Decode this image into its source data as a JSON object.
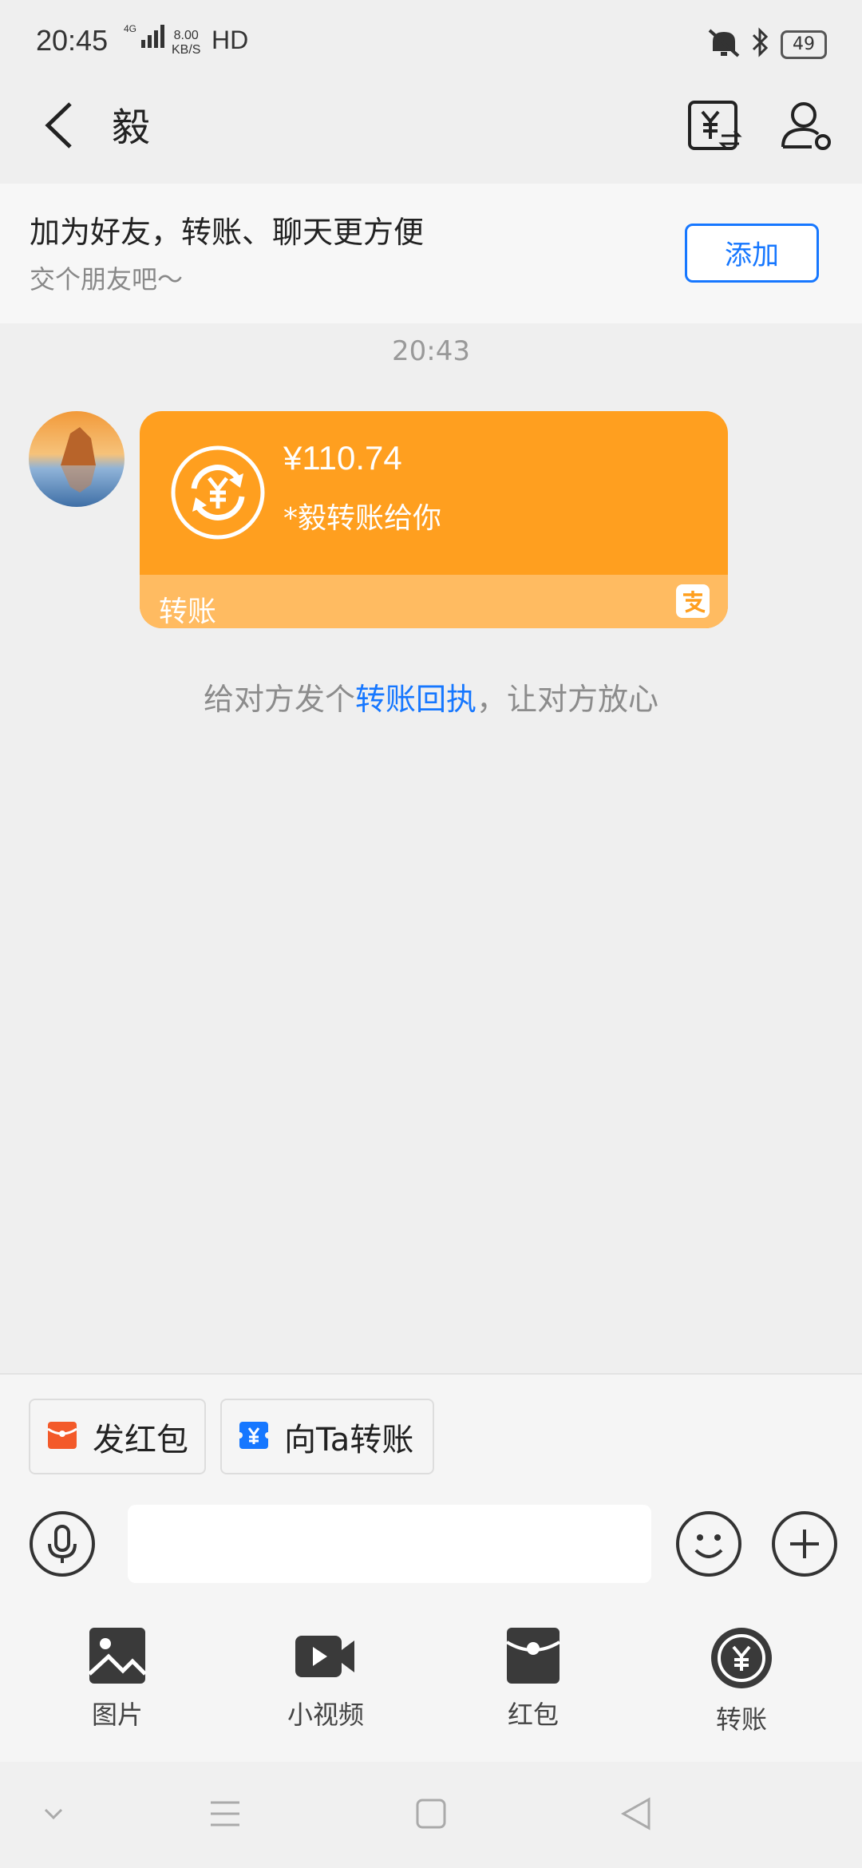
{
  "status_bar": {
    "time": "20:45",
    "network": "4G",
    "speed_value": "8.00",
    "speed_unit": "KB/S",
    "hd": "HD",
    "battery": "49"
  },
  "header": {
    "title": "毅"
  },
  "banner": {
    "heading": "加为好友，转账、聊天更方便",
    "subtext": "交个朋友吧～",
    "add_label": "添加"
  },
  "chat": {
    "timestamp": "20:43",
    "transfer_card": {
      "amount": "¥110.74",
      "description": "*毅转账给你",
      "footer_label": "转账"
    },
    "hint_prefix": "给对方发个",
    "hint_link": "转账回执",
    "hint_suffix": "，让对方放心"
  },
  "quick_actions": [
    {
      "label": "发红包",
      "icon": "red-envelope-icon"
    },
    {
      "label": "向Ta转账",
      "icon": "transfer-card-icon"
    }
  ],
  "tools": [
    {
      "label": "图片",
      "icon": "image-icon"
    },
    {
      "label": "小视频",
      "icon": "video-icon"
    },
    {
      "label": "红包",
      "icon": "red-packet-icon"
    },
    {
      "label": "转账",
      "icon": "transfer-icon"
    }
  ],
  "colors": {
    "accent_blue": "#1677ff",
    "card_orange": "#ff9f1f",
    "card_orange_light": "#ffbb61",
    "red_envelope": "#f35a2a"
  }
}
